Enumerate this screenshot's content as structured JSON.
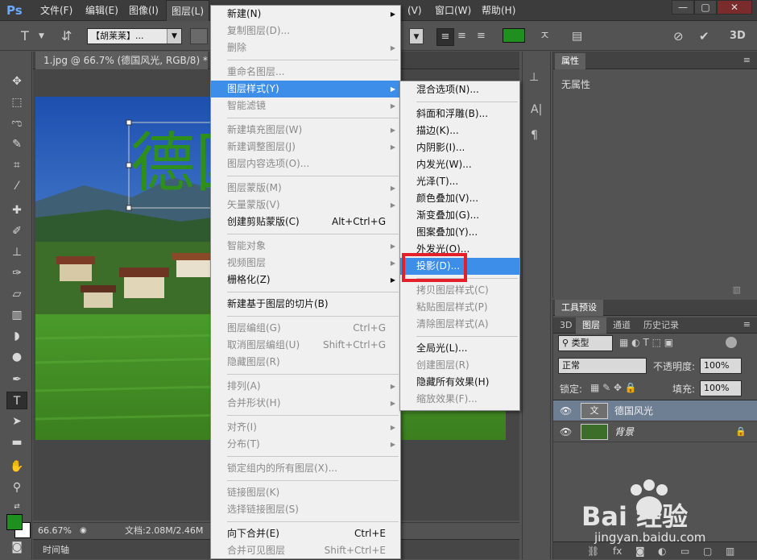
{
  "app": {
    "logo": "Ps",
    "window_min": "—",
    "window_max": "▢",
    "window_close": "✕"
  },
  "menubar": {
    "items": [
      "文件(F)",
      "编辑(E)",
      "图像(I)",
      "图层(L)",
      "(V)",
      "窗口(W)",
      "帮助(H)"
    ]
  },
  "options": {
    "font_family": "【胡莱莱】...",
    "text_color": "#1f8f1f"
  },
  "document": {
    "tab_title": "1.jpg @ 66.7% (德国风光, RGB/8) *",
    "overlay_text": "德国风"
  },
  "status": {
    "zoom": "66.67%",
    "doc_size": "文档:2.08M/2.46M",
    "timeline": "时间轴"
  },
  "properties": {
    "tab": "属性",
    "content": "无属性"
  },
  "layers_panel": {
    "tabs_top": [
      "工具预设"
    ],
    "tabs": [
      "3D",
      "图层",
      "通道",
      "历史记录"
    ],
    "filter_type": "类型",
    "blend_mode": "正常",
    "opacity_label": "不透明度:",
    "opacity_value": "100%",
    "lock_label": "锁定:",
    "fill_label": "填充:",
    "fill_value": "100%",
    "layers": [
      {
        "name": "德国风光",
        "thumb": "文"
      },
      {
        "name": "背景",
        "thumb": ""
      }
    ],
    "bottom_icons": [
      "link-icon",
      "fx-icon",
      "mask-icon",
      "adjustment-icon",
      "group-icon",
      "new-layer-icon",
      "trash-icon"
    ]
  },
  "layer_menu": {
    "items": [
      {
        "label": "新建(N)",
        "shortcut": "",
        "submenu": true,
        "disabled": false,
        "highlight": false
      },
      {
        "label": "复制图层(D)...",
        "shortcut": "",
        "submenu": false,
        "disabled": true,
        "highlight": false
      },
      {
        "label": "删除",
        "shortcut": "",
        "submenu": true,
        "disabled": true,
        "highlight": false
      },
      {
        "sep": true
      },
      {
        "label": "重命名图层...",
        "shortcut": "",
        "submenu": false,
        "disabled": true,
        "highlight": false
      },
      {
        "label": "图层样式(Y)",
        "shortcut": "",
        "submenu": true,
        "disabled": false,
        "highlight": true
      },
      {
        "label": "智能滤镜",
        "shortcut": "",
        "submenu": true,
        "disabled": true,
        "highlight": false
      },
      {
        "sep": true
      },
      {
        "label": "新建填充图层(W)",
        "shortcut": "",
        "submenu": true,
        "disabled": true,
        "highlight": false
      },
      {
        "label": "新建调整图层(J)",
        "shortcut": "",
        "submenu": true,
        "disabled": true,
        "highlight": false
      },
      {
        "label": "图层内容选项(O)...",
        "shortcut": "",
        "submenu": false,
        "disabled": true,
        "highlight": false
      },
      {
        "sep": true
      },
      {
        "label": "图层蒙版(M)",
        "shortcut": "",
        "submenu": true,
        "disabled": true,
        "highlight": false
      },
      {
        "label": "矢量蒙版(V)",
        "shortcut": "",
        "submenu": true,
        "disabled": true,
        "highlight": false
      },
      {
        "label": "创建剪贴蒙版(C)",
        "shortcut": "Alt+Ctrl+G",
        "submenu": false,
        "disabled": false,
        "highlight": false
      },
      {
        "sep": true
      },
      {
        "label": "智能对象",
        "shortcut": "",
        "submenu": true,
        "disabled": true,
        "highlight": false
      },
      {
        "label": "视频图层",
        "shortcut": "",
        "submenu": true,
        "disabled": true,
        "highlight": false
      },
      {
        "label": "栅格化(Z)",
        "shortcut": "",
        "submenu": true,
        "disabled": false,
        "highlight": false
      },
      {
        "sep": true
      },
      {
        "label": "新建基于图层的切片(B)",
        "shortcut": "",
        "submenu": false,
        "disabled": false,
        "highlight": false
      },
      {
        "sep": true
      },
      {
        "label": "图层编组(G)",
        "shortcut": "Ctrl+G",
        "submenu": false,
        "disabled": true,
        "highlight": false
      },
      {
        "label": "取消图层编组(U)",
        "shortcut": "Shift+Ctrl+G",
        "submenu": false,
        "disabled": true,
        "highlight": false
      },
      {
        "label": "隐藏图层(R)",
        "shortcut": "",
        "submenu": false,
        "disabled": true,
        "highlight": false
      },
      {
        "sep": true
      },
      {
        "label": "排列(A)",
        "shortcut": "",
        "submenu": true,
        "disabled": true,
        "highlight": false
      },
      {
        "label": "合并形状(H)",
        "shortcut": "",
        "submenu": true,
        "disabled": true,
        "highlight": false
      },
      {
        "sep": true
      },
      {
        "label": "对齐(I)",
        "shortcut": "",
        "submenu": true,
        "disabled": true,
        "highlight": false
      },
      {
        "label": "分布(T)",
        "shortcut": "",
        "submenu": true,
        "disabled": true,
        "highlight": false
      },
      {
        "sep": true
      },
      {
        "label": "锁定组内的所有图层(X)...",
        "shortcut": "",
        "submenu": false,
        "disabled": true,
        "highlight": false
      },
      {
        "sep": true
      },
      {
        "label": "链接图层(K)",
        "shortcut": "",
        "submenu": false,
        "disabled": true,
        "highlight": false
      },
      {
        "label": "选择链接图层(S)",
        "shortcut": "",
        "submenu": false,
        "disabled": true,
        "highlight": false
      },
      {
        "sep": true
      },
      {
        "label": "向下合并(E)",
        "shortcut": "Ctrl+E",
        "submenu": false,
        "disabled": false,
        "highlight": false
      },
      {
        "label": "合并可见图层",
        "shortcut": "Shift+Ctrl+E",
        "submenu": false,
        "disabled": true,
        "highlight": false
      }
    ]
  },
  "style_menu": {
    "items": [
      {
        "label": "混合选项(N)...",
        "disabled": false,
        "highlight": false
      },
      {
        "sep": true
      },
      {
        "label": "斜面和浮雕(B)...",
        "disabled": false,
        "highlight": false
      },
      {
        "label": "描边(K)...",
        "disabled": false,
        "highlight": false
      },
      {
        "label": "内阴影(I)...",
        "disabled": false,
        "highlight": false
      },
      {
        "label": "内发光(W)...",
        "disabled": false,
        "highlight": false
      },
      {
        "label": "光泽(T)...",
        "disabled": false,
        "highlight": false
      },
      {
        "label": "颜色叠加(V)...",
        "disabled": false,
        "highlight": false
      },
      {
        "label": "渐变叠加(G)...",
        "disabled": false,
        "highlight": false
      },
      {
        "label": "图案叠加(Y)...",
        "disabled": false,
        "highlight": false
      },
      {
        "label": "外发光(O)...",
        "disabled": false,
        "highlight": false
      },
      {
        "label": "投影(D)...",
        "disabled": false,
        "highlight": true
      },
      {
        "sep": true
      },
      {
        "label": "拷贝图层样式(C)",
        "disabled": true,
        "highlight": false
      },
      {
        "label": "粘贴图层样式(P)",
        "disabled": true,
        "highlight": false
      },
      {
        "label": "清除图层样式(A)",
        "disabled": true,
        "highlight": false
      },
      {
        "sep": true
      },
      {
        "label": "全局光(L)...",
        "disabled": false,
        "highlight": false
      },
      {
        "label": "创建图层(R)",
        "disabled": true,
        "highlight": false
      },
      {
        "label": "隐藏所有效果(H)",
        "disabled": false,
        "highlight": false
      },
      {
        "label": "缩放效果(F)...",
        "disabled": true,
        "highlight": false
      }
    ]
  },
  "watermark": {
    "brand": "Bai  经验",
    "url": "jingyan.baidu.com"
  }
}
